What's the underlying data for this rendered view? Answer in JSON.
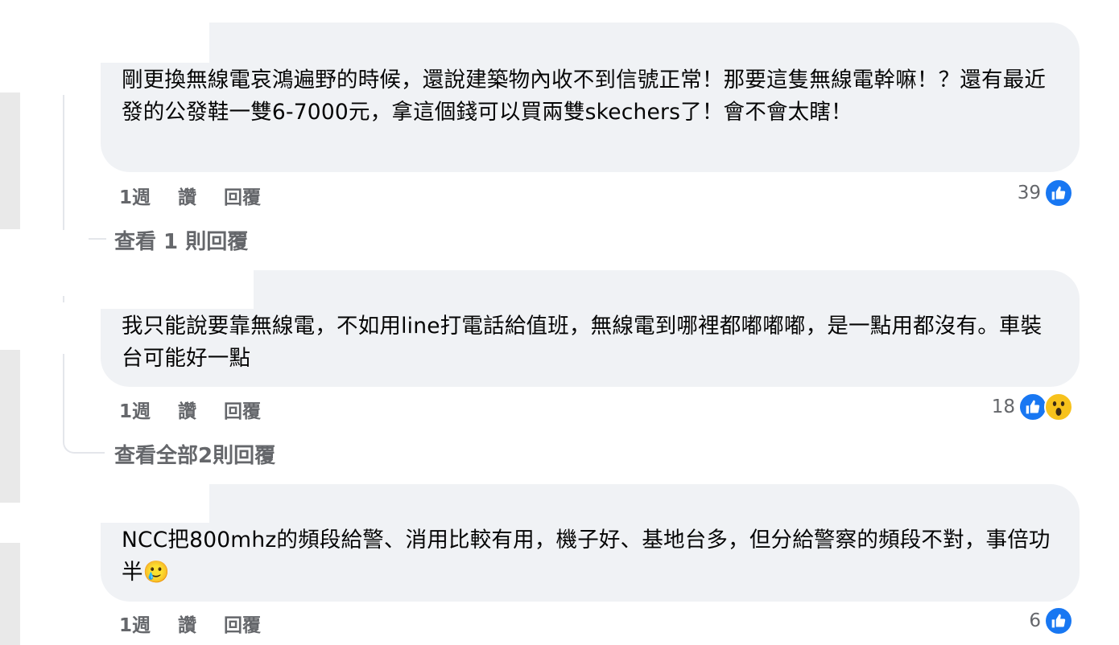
{
  "comments": [
    {
      "text": "剛更換無線電哀鴻遍野的時候，還說建築物內收不到信號正常！那要這隻無線電幹嘛！？還有最近發的公發鞋一雙6-7000元，拿這個錢可以買兩雙skechers了！會不會太瞎！",
      "time": "1週",
      "like_label": "讚",
      "reply_label": "回覆",
      "reaction_count": "39",
      "reactions": [
        "like-icon"
      ],
      "view_replies": "查看 1 則回覆"
    },
    {
      "text": "我只能說要靠無線電，不如用line打電話給值班，無線電到哪裡都嘟嘟嘟，是一點用都沒有。車裝台可能好一點",
      "time": "1週",
      "like_label": "讚",
      "reply_label": "回覆",
      "reaction_count": "18",
      "reactions": [
        "like-icon",
        "wow-icon"
      ],
      "view_replies": "查看全部2則回覆"
    },
    {
      "text": "NCC把800mhz的頻段給警、消用比較有用，機子好、基地台多，但分給警察的頻段不對，事倍功半",
      "emoji": "🥲",
      "time": "1週",
      "like_label": "讚",
      "reply_label": "回覆",
      "reaction_count": "6",
      "reactions": [
        "like-icon"
      ]
    }
  ],
  "colors": {
    "bubble": "#f0f2f5",
    "meta_text": "#65676b",
    "like_blue": "#1877f2",
    "wow_yellow": "#f7c21c"
  }
}
